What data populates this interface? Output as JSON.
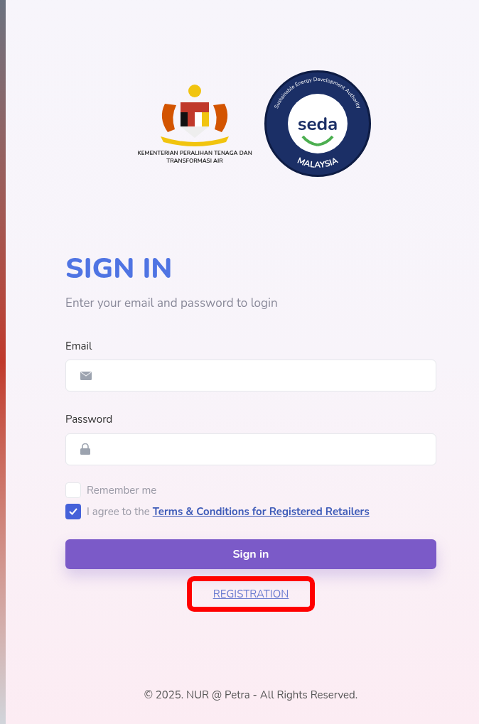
{
  "logos": {
    "ministry_caption": "KEMENTERIAN PERALIHAN TENAGA DAN TRANSFORMASI AIR",
    "seda_ring_top": "Sustainable Energy Development Authority",
    "seda_wordmark": "seda",
    "seda_ring_bottom": "MALAYSIA"
  },
  "title": "SIGN IN",
  "subtitle": "Enter your email and password to login",
  "fields": [
    {
      "label": "Email",
      "kind": "email"
    },
    {
      "label": "Password",
      "kind": "password"
    }
  ],
  "checkboxes": [
    {
      "label": "Remember me",
      "checked": false
    },
    {
      "label": "I agree to the ",
      "link": "Terms & Conditions for Registered Retailers",
      "checked": true
    }
  ],
  "submit_button": "Sign in",
  "registration_link": {
    "label": "REGISTRATION",
    "highlighted": true
  },
  "footer": "© 2025. NUR @ Petra - All Rights Reserved."
}
